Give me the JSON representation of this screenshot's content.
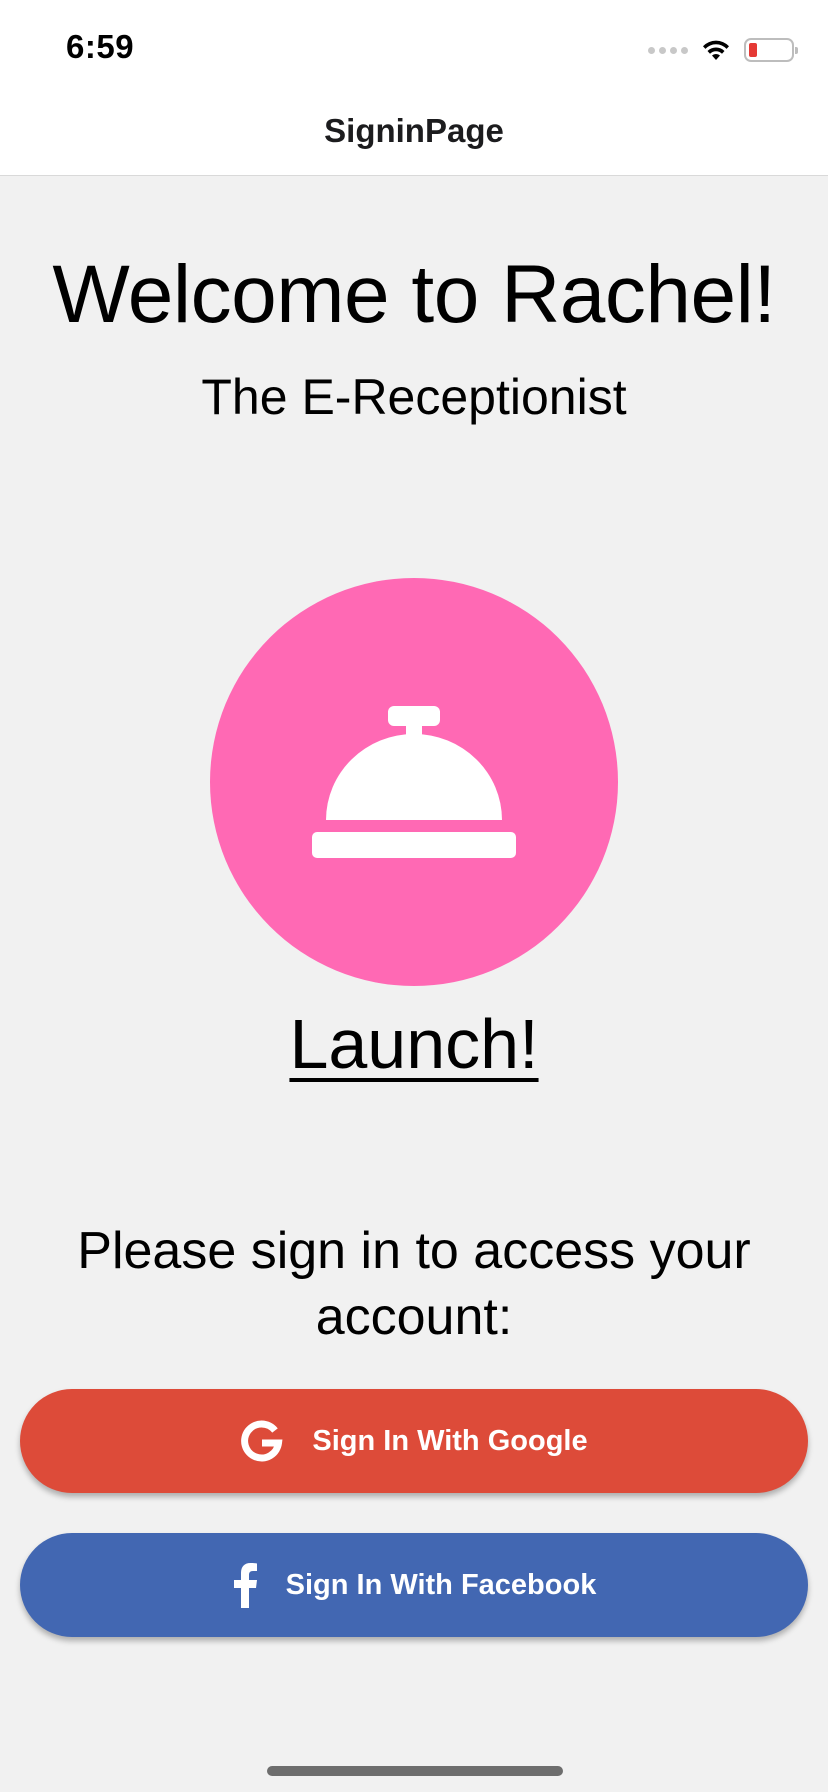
{
  "status_bar": {
    "time": "6:59",
    "battery_color": "#e53935"
  },
  "nav": {
    "title": "SigninPage"
  },
  "main": {
    "welcome": "Welcome to Rachel!",
    "subtitle": "The E-Receptionist",
    "launch_icon": "service-bell-icon",
    "launch_circle_color": "#ff69b4",
    "launch_label": "Launch!",
    "prompt": "Please sign in to access your account:"
  },
  "buttons": {
    "google": {
      "label": "Sign In With Google",
      "icon": "google-icon",
      "color": "#dd4b39"
    },
    "facebook": {
      "label": "Sign In With Facebook",
      "icon": "facebook-icon",
      "color": "#4267b2"
    }
  }
}
